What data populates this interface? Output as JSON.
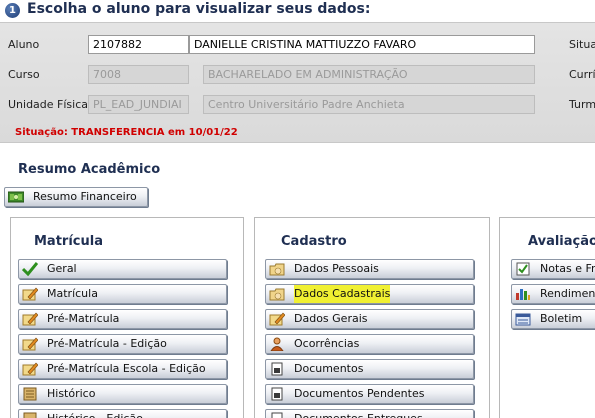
{
  "header": {
    "step": "1",
    "title": "Escolha o aluno para visualizar seus dados:"
  },
  "student": {
    "aluno_label": "Aluno",
    "aluno_id": "2107882",
    "aluno_nome": "DANIELLE CRISTINA MATTIUZZO FAVARO",
    "curso_label": "Curso",
    "curso_code": "7008",
    "curso_nome": "BACHARELADO EM ADMINISTRAÇÃO",
    "unidade_label": "Unidade Física",
    "unidade_code": "PL_EAD_JUNDIAI",
    "unidade_nome": "Centro Universitário Padre Anchieta",
    "right_labels": [
      "Situa",
      "Currí",
      "Turm"
    ],
    "status": "Situação: TRANSFERENCIA em 10/01/22"
  },
  "resumo": {
    "title": "Resumo Acadêmico",
    "financeiro": "Resumo Financeiro"
  },
  "matricula": {
    "title": "Matrícula",
    "items": [
      "Geral",
      "Matrícula",
      "Pré-Matrícula",
      "Pré-Matrícula - Edição",
      "Pré-Matrícula Escola - Edição",
      "Histórico",
      "Histórico - Edição"
    ]
  },
  "cadastro": {
    "title": "Cadastro",
    "items": [
      "Dados Pessoais",
      "Dados Cadastrais",
      "Dados Gerais",
      "Ocorrências",
      "Documentos",
      "Documentos Pendentes",
      "Documentos Entregues"
    ]
  },
  "avaliacao": {
    "title": "Avaliação",
    "items": [
      "Notas e Fre",
      "Rendiment",
      "Boletim"
    ]
  },
  "colors": {
    "title": "#1f2f52",
    "status": "#d00000",
    "highlight": "#f0f032"
  }
}
